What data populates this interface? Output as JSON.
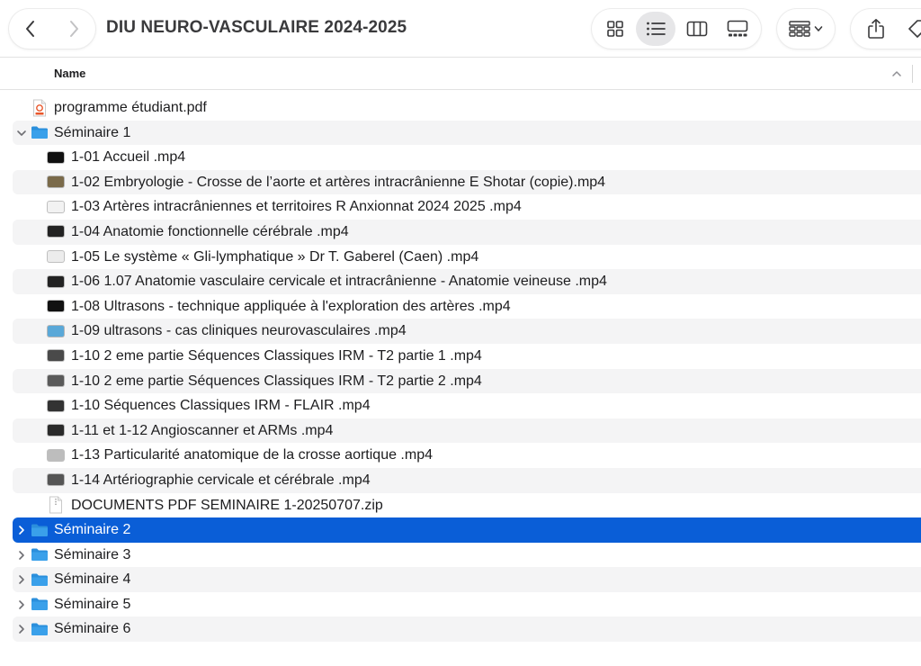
{
  "window": {
    "title": "DIU NEURO-VASCULAIRE 2024-2025"
  },
  "toolbar": {
    "back_icon": "chevron-left-icon",
    "forward_icon": "chevron-right-icon",
    "views": [
      "icon-view",
      "list-view",
      "column-view",
      "gallery-view"
    ],
    "active_view": "list-view",
    "group_icon": "group-grid-icon",
    "share_icon": "share-icon",
    "tag_icon": "tag-icon"
  },
  "header": {
    "name_column": "Name",
    "sort": "ascending"
  },
  "colors": {
    "selection": "#0a5ed7",
    "folder": "#3aa0ea",
    "alt_row": "#f4f4f5"
  },
  "items": [
    {
      "label": "programme étudiant.pdf",
      "level": 0,
      "kind": "pdf"
    },
    {
      "label": "Séminaire 1",
      "level": 0,
      "kind": "folder",
      "expanded": true
    },
    {
      "label": "1-01 Accueil .mp4",
      "level": 1,
      "kind": "video",
      "thumb": "#111111"
    },
    {
      "label": "1-02 Embryologie - Crosse de l’aorte et artères intracrânienne E Shotar (copie).mp4",
      "level": 1,
      "kind": "video",
      "thumb": "#7a6a4a"
    },
    {
      "label": "1-03 Artères intracrâniennes et territoires R Anxionnat 2024 2025 .mp4",
      "level": 1,
      "kind": "video",
      "thumb": "#f2f2f2"
    },
    {
      "label": "1-04 Anatomie fonctionnelle cérébrale .mp4",
      "level": 1,
      "kind": "video",
      "thumb": "#222222"
    },
    {
      "label": "1-05 Le système « Gli-lymphatique » Dr T. Gaberel (Caen) .mp4",
      "level": 1,
      "kind": "video",
      "thumb": "#ececec"
    },
    {
      "label": "1-06 1.07 Anatomie vasculaire cervicale et intracrânienne - Anatomie veineuse .mp4",
      "level": 1,
      "kind": "video",
      "thumb": "#222222"
    },
    {
      "label": "1-08 Ultrasons - technique appliquée à l'exploration des artères .mp4",
      "level": 1,
      "kind": "video",
      "thumb": "#111111"
    },
    {
      "label": "1-09 ultrasons - cas cliniques neurovasculaires .mp4",
      "level": 1,
      "kind": "video",
      "thumb": "#5aa8d8"
    },
    {
      "label": "1-10 2 eme partie Séquences Classiques IRM - T2 partie 1 .mp4",
      "level": 1,
      "kind": "video",
      "thumb": "#4a4a4a"
    },
    {
      "label": "1-10 2 eme partie Séquences Classiques IRM - T2 partie 2 .mp4",
      "level": 1,
      "kind": "video",
      "thumb": "#5a5a5a"
    },
    {
      "label": "1-10 Séquences Classiques IRM - FLAIR .mp4",
      "level": 1,
      "kind": "video",
      "thumb": "#333333"
    },
    {
      "label": "1-11 et 1-12 Angioscanner et ARMs .mp4",
      "level": 1,
      "kind": "video",
      "thumb": "#2a2a2a"
    },
    {
      "label": "1-13 Particularité anatomique de la crosse aortique .mp4",
      "level": 1,
      "kind": "video",
      "thumb": "#bdbdbd"
    },
    {
      "label": "1-14 Artériographie cervicale et cérébrale .mp4",
      "level": 1,
      "kind": "video",
      "thumb": "#555555"
    },
    {
      "label": "DOCUMENTS PDF SEMINAIRE 1-20250707.zip",
      "level": 1,
      "kind": "zip"
    },
    {
      "label": "Séminaire 2",
      "level": 0,
      "kind": "folder",
      "expanded": false,
      "selected": true
    },
    {
      "label": "Séminaire 3",
      "level": 0,
      "kind": "folder",
      "expanded": false
    },
    {
      "label": "Séminaire 4",
      "level": 0,
      "kind": "folder",
      "expanded": false
    },
    {
      "label": "Séminaire 5",
      "level": 0,
      "kind": "folder",
      "expanded": false
    },
    {
      "label": "Séminaire 6",
      "level": 0,
      "kind": "folder",
      "expanded": false
    }
  ]
}
